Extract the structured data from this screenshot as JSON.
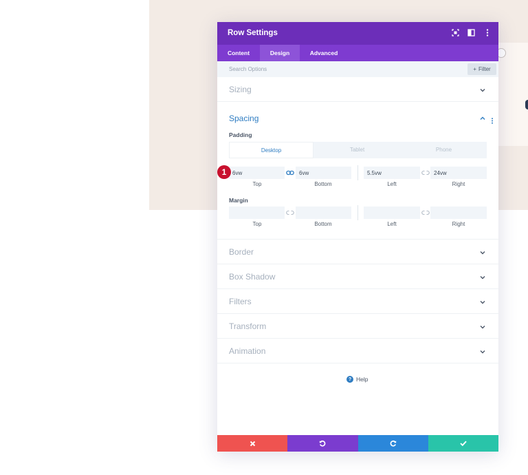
{
  "page": {
    "background_color": "#ffffff",
    "backdrop_color": "#f3ebe5"
  },
  "modal": {
    "title": "Row Settings",
    "header_icons": [
      "screenshot-icon",
      "split-view-icon",
      "more-vertical-icon"
    ],
    "tabs": [
      {
        "label": "Content",
        "active": false
      },
      {
        "label": "Design",
        "active": true
      },
      {
        "label": "Advanced",
        "active": false
      }
    ],
    "search": {
      "placeholder": "Search Options",
      "filter_label": "Filter"
    }
  },
  "sections": {
    "sizing": "Sizing",
    "spacing": "Spacing",
    "border": "Border",
    "box_shadow": "Box Shadow",
    "filters": "Filters",
    "transform": "Transform",
    "animation": "Animation"
  },
  "spacing": {
    "padding_label": "Padding",
    "margin_label": "Margin",
    "device_tabs": [
      "Desktop",
      "Tablet",
      "Phone"
    ],
    "active_device": "Desktop",
    "padding": {
      "top": "6vw",
      "bottom": "6vw",
      "left": "5.5vw",
      "right": "24vw"
    },
    "margin": {
      "top": "",
      "bottom": "",
      "left": "",
      "right": ""
    },
    "side_labels": {
      "top": "Top",
      "bottom": "Bottom",
      "left": "Left",
      "right": "Right"
    },
    "step_badge": "1"
  },
  "help_label": "Help",
  "footer": {
    "buttons": [
      {
        "name": "discard",
        "icon": "close-icon",
        "color": "#ef5350"
      },
      {
        "name": "undo",
        "icon": "undo-icon",
        "color": "#7b3ccf"
      },
      {
        "name": "redo",
        "icon": "redo-icon",
        "color": "#2b87da"
      },
      {
        "name": "save",
        "icon": "check-icon",
        "color": "#29c4a9"
      }
    ]
  },
  "colors": {
    "accent": "#2f7dc2",
    "header": "#6c2eb9",
    "tabs": "#7e3bd0",
    "badge": "#c8102e"
  }
}
